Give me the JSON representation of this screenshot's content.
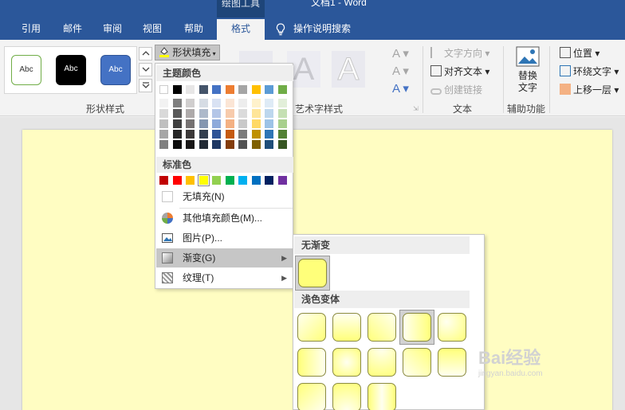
{
  "titlebar": {
    "contextual_tab_group": "绘图工具",
    "document_title": "文档1  -  Word",
    "tabs": [
      "引用",
      "邮件",
      "审阅",
      "视图",
      "帮助",
      "格式"
    ],
    "active_tab": "格式",
    "tell_me": "操作说明搜索"
  },
  "ribbon": {
    "shape_styles": {
      "swatch_labels": [
        "Abc",
        "Abc",
        "Abc"
      ],
      "group_label": "形状样式"
    },
    "shape_fill_button": "形状填充",
    "wordart": {
      "group_label": "艺术字样式"
    },
    "text_group": {
      "text_direction": "文字方向",
      "align_text": "对齐文本",
      "create_link": "创建链接",
      "group_label": "文本"
    },
    "accessibility": {
      "alt_text_line1": "替换",
      "alt_text_line2": "文字",
      "group_label": "辅助功能"
    },
    "arrange": {
      "position": "位置",
      "wrap_text": "环绕文字",
      "bring_forward": "上移一层"
    }
  },
  "fill_menu": {
    "theme_colors_header": "主题颜色",
    "theme_colors": [
      [
        "#ffffff",
        "#f2f2f2",
        "#d9d9d9",
        "#bfbfbf",
        "#a6a6a6",
        "#808080"
      ],
      [
        "#000000",
        "#7f7f7f",
        "#595959",
        "#3f3f3f",
        "#262626",
        "#0d0d0d"
      ],
      [
        "#e7e6e6",
        "#d0cece",
        "#aeaaaa",
        "#757171",
        "#3b3838",
        "#171616"
      ],
      [
        "#44546a",
        "#d6dce4",
        "#adb9ca",
        "#8496b0",
        "#333f4f",
        "#222a35"
      ],
      [
        "#4472c4",
        "#d9e2f3",
        "#b4c6e7",
        "#8eaadb",
        "#2f5496",
        "#1f3864"
      ],
      [
        "#ed7d31",
        "#fbe5d5",
        "#f7cbac",
        "#f4b183",
        "#c55a11",
        "#833c0b"
      ],
      [
        "#a5a5a5",
        "#ededed",
        "#dbdbdb",
        "#c9c9c9",
        "#7b7b7b",
        "#525252"
      ],
      [
        "#ffc000",
        "#fff2cc",
        "#fee599",
        "#ffd965",
        "#bf9000",
        "#7f6000"
      ],
      [
        "#5b9bd5",
        "#deebf6",
        "#bdd7ee",
        "#9dc3e6",
        "#2e75b5",
        "#1f4e79"
      ],
      [
        "#70ad47",
        "#e2efd9",
        "#c5e0b3",
        "#a8d08d",
        "#538135",
        "#375623"
      ]
    ],
    "standard_colors_header": "标准色",
    "standard_colors": [
      "#c00000",
      "#ff0000",
      "#ffc000",
      "#ffff00",
      "#92d050",
      "#00b050",
      "#00b0f0",
      "#0070c0",
      "#002060",
      "#7030a0"
    ],
    "selected_standard_color": "#ffff00",
    "no_fill": "无填充(N)",
    "more_colors": "其他填充颜色(M)...",
    "picture": "图片(P)...",
    "gradient": "渐变(G)",
    "texture": "纹理(T)"
  },
  "gradient_menu": {
    "no_gradient_header": "无渐变",
    "light_variations_header": "浅色变体",
    "base_color": "#ffff7a",
    "variations": [
      "linear-top-left",
      "linear-top",
      "linear-top-right",
      "linear-left",
      "linear-radial",
      "linear-right",
      "radial-center",
      "radial-top",
      "linear-bottom-left",
      "linear-bottom",
      "linear-bottom-right",
      "radial-bottom",
      "linear-center"
    ],
    "selected_variation": "linear-left"
  },
  "watermark": {
    "line1": "Bai经验",
    "line2": "jingyan.baidu.com"
  }
}
